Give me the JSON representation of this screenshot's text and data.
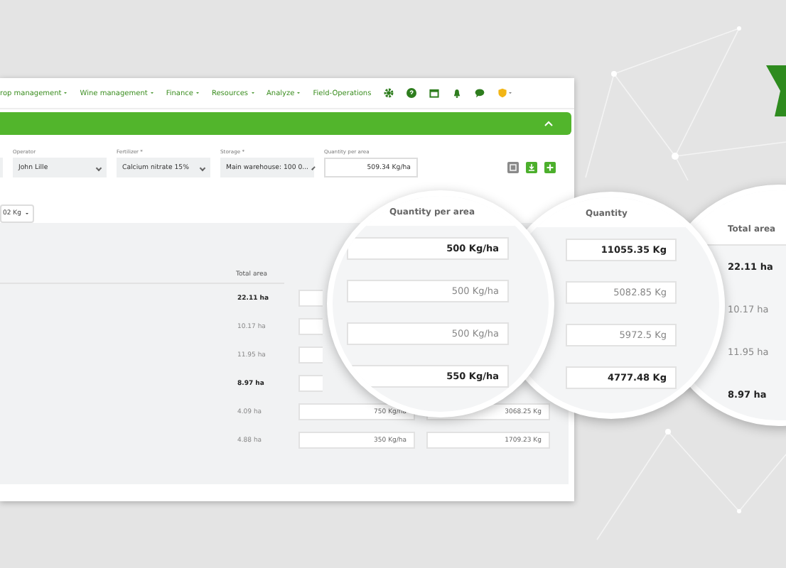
{
  "nav": {
    "items": [
      {
        "label": "rop management",
        "dropdown": true
      },
      {
        "label": "Wine management",
        "dropdown": true
      },
      {
        "label": "Finance",
        "dropdown": true
      },
      {
        "label": "Resources",
        "dropdown": true
      },
      {
        "label": "Analyze",
        "dropdown": true
      },
      {
        "label": "Field-Operations",
        "dropdown": false
      }
    ]
  },
  "form": {
    "fields": [
      {
        "label": "Operator",
        "value": "John Lille",
        "kind": "select"
      },
      {
        "label": "Fertilizer *",
        "value": "Calcium nitrate 15%",
        "kind": "select"
      },
      {
        "label": "Storage *",
        "value": "Main warehouse: 100 0...",
        "kind": "select"
      },
      {
        "label": "Quantity per area",
        "value": "509.34 Kg/ha",
        "kind": "input"
      }
    ]
  },
  "unit_select": {
    "value": "02 Kg"
  },
  "table": {
    "columns": [
      "Total area"
    ],
    "rows": [
      {
        "total_area": "22.11 ha",
        "bold": true
      },
      {
        "total_area": "10.17 ha",
        "bold": false
      },
      {
        "total_area": "11.95 ha",
        "bold": false
      },
      {
        "total_area": "8.97 ha",
        "bold": true
      },
      {
        "total_area": "4.09 ha",
        "bold": false,
        "quantity_per_area": "750 Kg/ha",
        "quantity": "3068.25 Kg"
      },
      {
        "total_area": "4.88 ha",
        "bold": false,
        "quantity_per_area": "350 Kg/ha",
        "quantity": "1709.23 Kg"
      }
    ]
  },
  "magnifiers": [
    {
      "kind": "fields",
      "header": "Quantity per area",
      "rows": [
        {
          "value": "500 Kg/ha",
          "bold": true
        },
        {
          "value": "500 Kg/ha",
          "bold": false
        },
        {
          "value": "500 Kg/ha",
          "bold": false
        },
        {
          "value": "550 Kg/ha",
          "bold": true
        }
      ]
    },
    {
      "kind": "fields",
      "header": "Quantity",
      "rows": [
        {
          "value": "11055.35 Kg",
          "bold": true
        },
        {
          "value": "5082.85 Kg",
          "bold": false
        },
        {
          "value": "5972.5 Kg",
          "bold": false
        },
        {
          "value": "4777.48 Kg",
          "bold": true
        }
      ]
    },
    {
      "kind": "text",
      "header": "Total area",
      "rows": [
        {
          "value": "22.11 ha",
          "bold": true
        },
        {
          "value": "10.17 ha",
          "bold": false
        },
        {
          "value": "11.95 ha",
          "bold": false
        },
        {
          "value": "8.97 ha",
          "bold": true
        }
      ]
    }
  ]
}
